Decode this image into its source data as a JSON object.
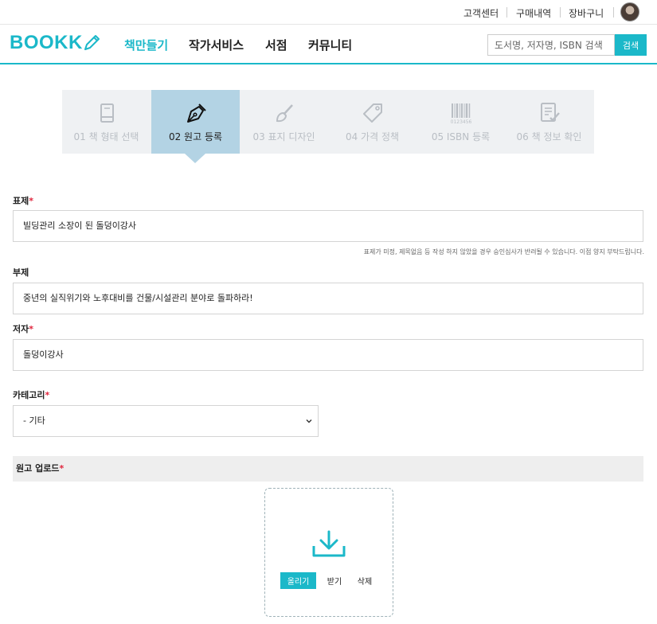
{
  "util_nav": {
    "customer_center": "고객센터",
    "purchase_history": "구매내역",
    "cart": "장바구니"
  },
  "header": {
    "logo": "BOOKK",
    "nav": [
      "책만들기",
      "작가서비스",
      "서점",
      "커뮤니티"
    ],
    "search_placeholder": "도서명, 저자명, ISBN 검색",
    "search_button": "검색"
  },
  "steps": [
    {
      "label": "01 책 형태 선택",
      "icon": "book-icon",
      "active": false
    },
    {
      "label": "02 원고 등록",
      "icon": "pen-nib-icon",
      "active": true
    },
    {
      "label": "03 표지 디자인",
      "icon": "brush-icon",
      "active": false
    },
    {
      "label": "04 가격 정책",
      "icon": "price-tag-icon",
      "active": false
    },
    {
      "label": "05 ISBN 등록",
      "icon": "barcode-icon",
      "active": false
    },
    {
      "label": "06 책 정보 확인",
      "icon": "checklist-icon",
      "active": false
    }
  ],
  "barcode_digits": "0123456",
  "form": {
    "title_label": "표제",
    "title_value": "빌딩관리 소장이 된 돌덩이강사",
    "title_hint": "표제가 미정, 제목없음 등 작성 하지 않았을 경우 승인심사가 반려될 수 있습니다. 이점 양지 부탁드립니다.",
    "subtitle_label": "부제",
    "subtitle_value": "중년의 실직위기와 노후대비를 건물/시설관리 분야로 돌파하라!",
    "author_label": "저자",
    "author_value": "돌덩이강사",
    "category_label": "카테고리",
    "category_value": "- 기타",
    "upload_label": "원고 업로드",
    "upload_button": "올리기",
    "download_button": "받기",
    "delete_button": "삭제"
  },
  "colors": {
    "accent": "#1bb8c9",
    "active_step": "#b3d3e4",
    "required": "#e0243c"
  }
}
